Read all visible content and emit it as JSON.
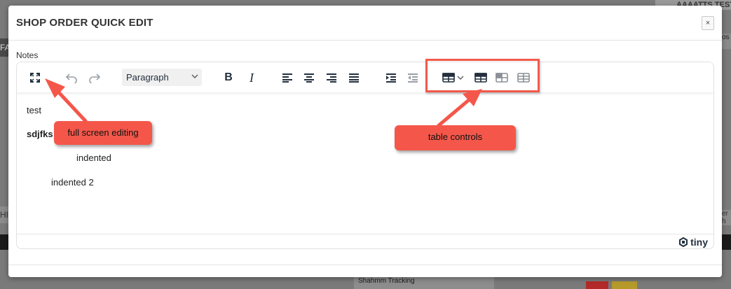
{
  "background": {
    "top_right_text": "AAAATTS TEST",
    "right_input_text": "os",
    "right_search_text": "er h",
    "left_header_text": "FA",
    "left_section_text": "HIS",
    "bottom_bar_text": "Shahmm Tracking"
  },
  "modal": {
    "title": "SHOP ORDER QUICK EDIT",
    "close_label": "×",
    "notes_label": "Notes"
  },
  "toolbar": {
    "block_format": "Paragraph",
    "bold_label": "B",
    "italic_label": "I"
  },
  "content": {
    "lines": [
      "test",
      "sdjfks",
      "indented",
      "indented 2"
    ]
  },
  "statusbar": {
    "brand": "tiny"
  },
  "annotations": {
    "fullscreen_callout": "full screen editing",
    "table_callout": "table controls"
  },
  "colors": {
    "callout": "#f4574a",
    "toolbar_icon": "#222f3e",
    "disabled_icon": "#9aa0a6",
    "overlay": "#7a7a7a"
  }
}
